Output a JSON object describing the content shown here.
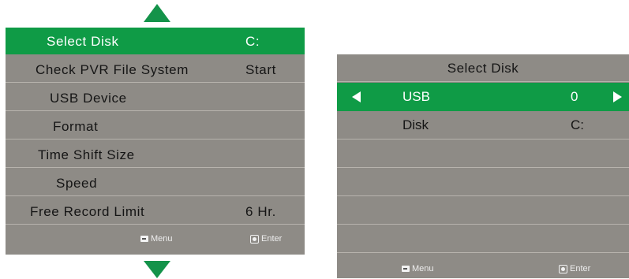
{
  "colors": {
    "accent_green": "#0f9b46",
    "panel_gray": "#8e8b86",
    "row_divider": "#b7b3ad"
  },
  "left_menu": {
    "scroll_up_icon": "triangle-up-icon",
    "scroll_down_icon": "triangle-down-icon",
    "items": [
      {
        "label": "Select Disk",
        "value": "C:",
        "selected": true
      },
      {
        "label": "Check PVR File System",
        "value": "Start",
        "selected": false
      },
      {
        "label": "USB Device",
        "value": "",
        "selected": false
      },
      {
        "label": "Format",
        "value": "",
        "selected": false
      },
      {
        "label": "Time Shift Size",
        "value": "",
        "selected": false
      },
      {
        "label": "Speed",
        "value": "",
        "selected": false
      },
      {
        "label": "Free Record Limit",
        "value": "6 Hr.",
        "selected": false
      }
    ],
    "footer": {
      "menu_icon": "menu-key-icon",
      "menu_label": "Menu",
      "enter_icon": "enter-key-icon",
      "enter_label": "Enter"
    }
  },
  "right_menu": {
    "title": "Select Disk",
    "items": [
      {
        "label": "USB",
        "value": "0",
        "selected": true,
        "left_arrow_icon": "arrow-left-icon",
        "right_arrow_icon": "arrow-right-icon"
      },
      {
        "label": "Disk",
        "value": "C:",
        "selected": false
      }
    ],
    "footer": {
      "menu_icon": "menu-key-icon",
      "menu_label": "Menu",
      "enter_icon": "enter-key-icon",
      "enter_label": "Enter"
    }
  }
}
